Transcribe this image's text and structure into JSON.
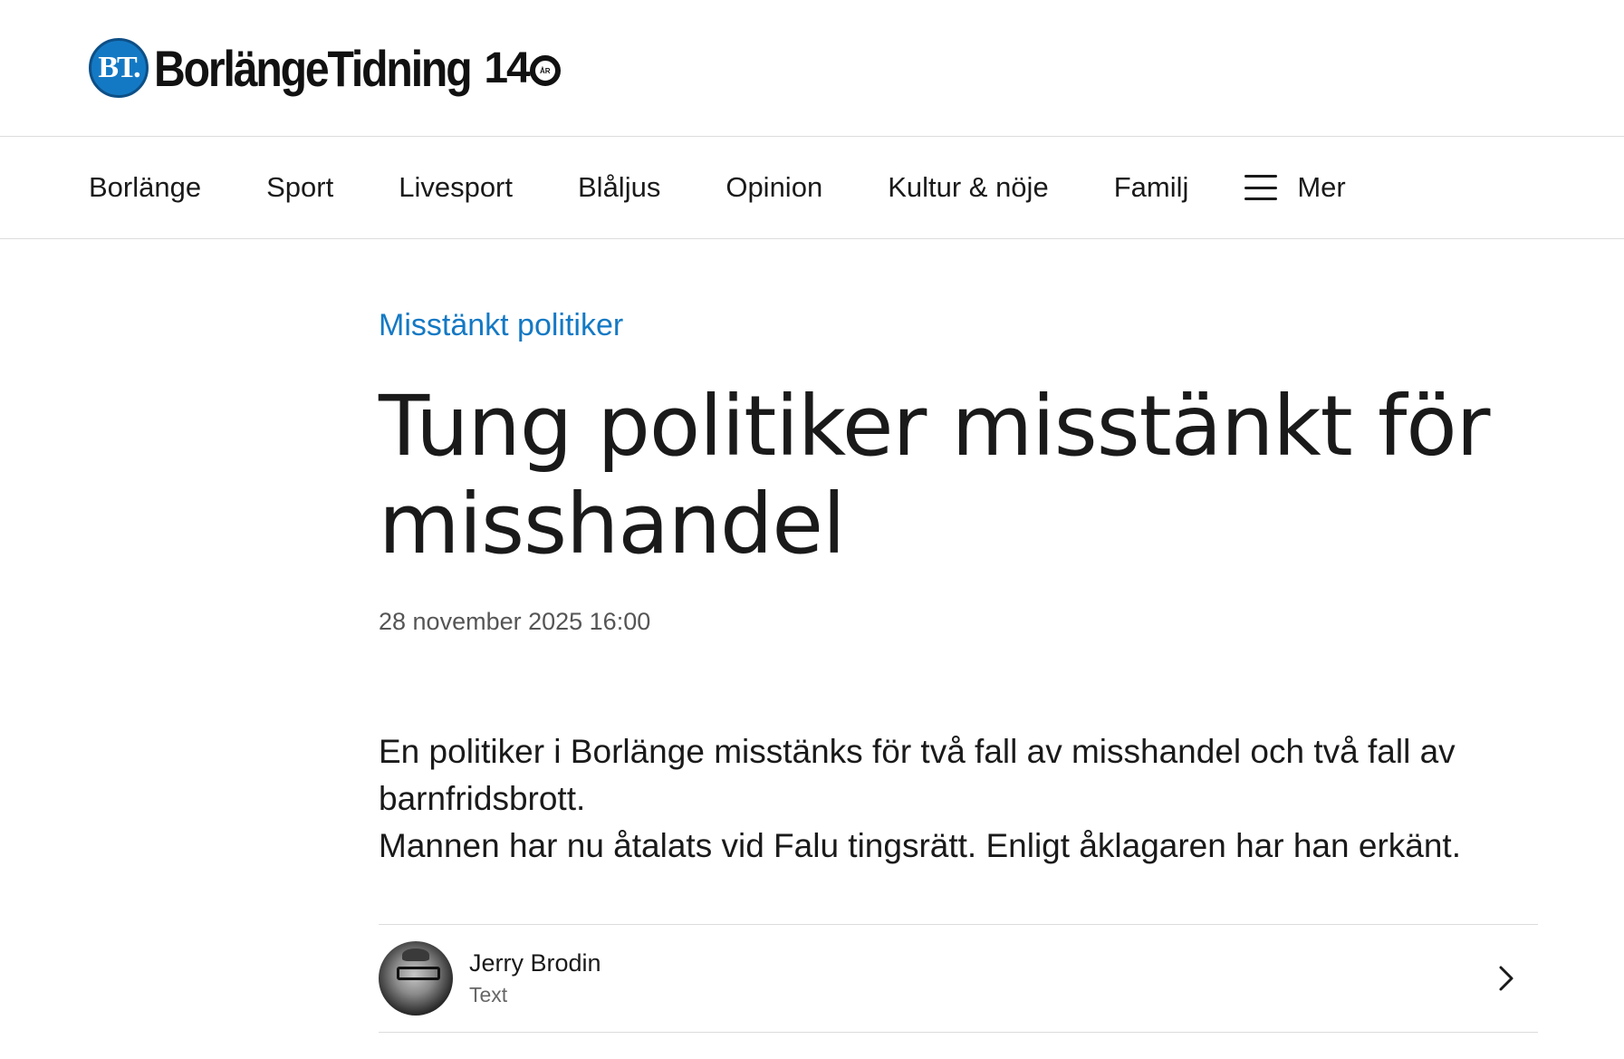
{
  "brand": {
    "badge": "BT.",
    "name": "BorlängeTidning",
    "anniversary_number": "14",
    "anniversary_suffix": "ÅR",
    "badge_color": "#1479c4"
  },
  "nav": {
    "items": [
      {
        "label": "Borlänge"
      },
      {
        "label": "Sport"
      },
      {
        "label": "Livesport"
      },
      {
        "label": "Blåljus"
      },
      {
        "label": "Opinion"
      },
      {
        "label": "Kultur & nöje"
      },
      {
        "label": "Familj"
      }
    ],
    "more_label": "Mer",
    "more_icon": "hamburger-icon"
  },
  "article": {
    "kicker": "Misstänkt politiker",
    "kicker_color": "#1479c4",
    "headline": "Tung politiker misstänkt för misshandel",
    "timestamp": "28 november 2025 16:00",
    "lead": [
      "En politiker i Borlänge misstänks för två fall av misshandel och två fall av barnfridsbrott.",
      "Mannen har nu åtalats vid Falu tingsrätt. Enligt åklagaren har han erkänt."
    ]
  },
  "byline": {
    "author": "Jerry Brodin",
    "role": "Text",
    "icon": "chevron-right-icon"
  }
}
